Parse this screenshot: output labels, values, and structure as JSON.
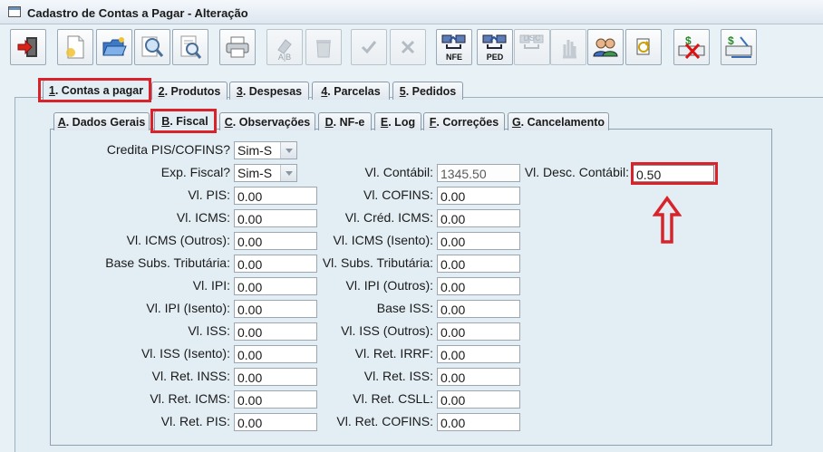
{
  "window": {
    "title": "Cadastro de Contas a Pagar - Alteração"
  },
  "toolbar": {
    "buttons": [
      {
        "name": "exit-button",
        "icon": "exit-door-icon"
      },
      {
        "name": "new-button",
        "icon": "new-document-icon"
      },
      {
        "name": "open-button",
        "icon": "open-folder-icon"
      },
      {
        "name": "search-button",
        "icon": "magnifier-icon"
      },
      {
        "name": "preview-button",
        "icon": "document-search-icon"
      },
      {
        "name": "print-button",
        "icon": "printer-icon"
      },
      {
        "name": "sort-button",
        "icon": "ab-sort-icon",
        "label": "A|B"
      },
      {
        "name": "delete-button",
        "icon": "trash-icon"
      },
      {
        "name": "confirm-button",
        "icon": "check-icon"
      },
      {
        "name": "cancel-button",
        "icon": "x-icon"
      },
      {
        "name": "nfe-button",
        "icon": "network-nfe-icon",
        "label": "NFE"
      },
      {
        "name": "ped-button",
        "icon": "network-ped-icon",
        "label": "PED"
      },
      {
        "name": "dsc-button",
        "icon": "network-dsc-icon",
        "label": "DSC"
      },
      {
        "name": "hand-button",
        "icon": "hand-icon"
      },
      {
        "name": "users-button",
        "icon": "users-icon"
      },
      {
        "name": "refresh-button",
        "icon": "refresh-doc-icon"
      },
      {
        "name": "money-cancel-button",
        "icon": "money-cancel-icon"
      },
      {
        "name": "money-edit-button",
        "icon": "money-edit-icon"
      }
    ]
  },
  "main_tabs": [
    {
      "key": "1",
      "label": ". Contas a pagar",
      "active": true
    },
    {
      "key": "2",
      "label": ". Produtos"
    },
    {
      "key": "3",
      "label": ". Despesas"
    },
    {
      "key": "4",
      "label": ". Parcelas"
    },
    {
      "key": "5",
      "label": ". Pedidos"
    }
  ],
  "sub_tabs": [
    {
      "key": "A",
      "label": ". Dados Gerais"
    },
    {
      "key": "B",
      "label": ". Fiscal",
      "active": true
    },
    {
      "key": "C",
      "label": ". Observações"
    },
    {
      "key": "D",
      "label": ". NF-e"
    },
    {
      "key": "E",
      "label": ". Log"
    },
    {
      "key": "F",
      "label": ". Correções"
    },
    {
      "key": "G",
      "label": ". Cancelamento"
    }
  ],
  "form": {
    "credita_pis_cofins": {
      "label": "Credita PIS/COFINS?",
      "value": "Sim-S"
    },
    "exp_fiscal": {
      "label": "Exp. Fiscal?",
      "value": "Sim-S"
    },
    "vl_contabil": {
      "label": "Vl. Contábil:",
      "value": "1345.50"
    },
    "vl_desc_contabil": {
      "label": "Vl. Desc. Contábil:",
      "value": "0.50"
    },
    "left": [
      {
        "label": "Vl. PIS:",
        "value": "0.00"
      },
      {
        "label": "Vl. ICMS:",
        "value": "0.00"
      },
      {
        "label": "Vl. ICMS (Outros):",
        "value": "0.00"
      },
      {
        "label": "Base Subs. Tributária:",
        "value": "0.00"
      },
      {
        "label": "Vl. IPI:",
        "value": "0.00"
      },
      {
        "label": "Vl. IPI (Isento):",
        "value": "0.00"
      },
      {
        "label": "Vl. ISS:",
        "value": "0.00"
      },
      {
        "label": "Vl. ISS (Isento):",
        "value": "0.00"
      },
      {
        "label": "Vl. Ret. INSS:",
        "value": "0.00"
      },
      {
        "label": "Vl. Ret. ICMS:",
        "value": "0.00"
      },
      {
        "label": "Vl. Ret. PIS:",
        "value": "0.00"
      }
    ],
    "right": [
      {
        "label": "Vl. COFINS:",
        "value": "0.00"
      },
      {
        "label": "Vl. Créd. ICMS:",
        "value": "0.00"
      },
      {
        "label": "Vl. ICMS (Isento):",
        "value": "0.00"
      },
      {
        "label": "Vl. Subs. Tributária:",
        "value": "0.00"
      },
      {
        "label": "Vl. IPI (Outros):",
        "value": "0.00"
      },
      {
        "label": "Base ISS:",
        "value": "0.00"
      },
      {
        "label": "Vl. ISS (Outros):",
        "value": "0.00"
      },
      {
        "label": "Vl. Ret. IRRF:",
        "value": "0.00"
      },
      {
        "label": "Vl. Ret. ISS:",
        "value": "0.00"
      },
      {
        "label": "Vl. Ret. CSLL:",
        "value": "0.00"
      },
      {
        "label": "Vl. Ret. COFINS:",
        "value": "0.00"
      }
    ]
  },
  "colors": {
    "highlight": "#d9222a",
    "background": "#e8f1f6"
  }
}
